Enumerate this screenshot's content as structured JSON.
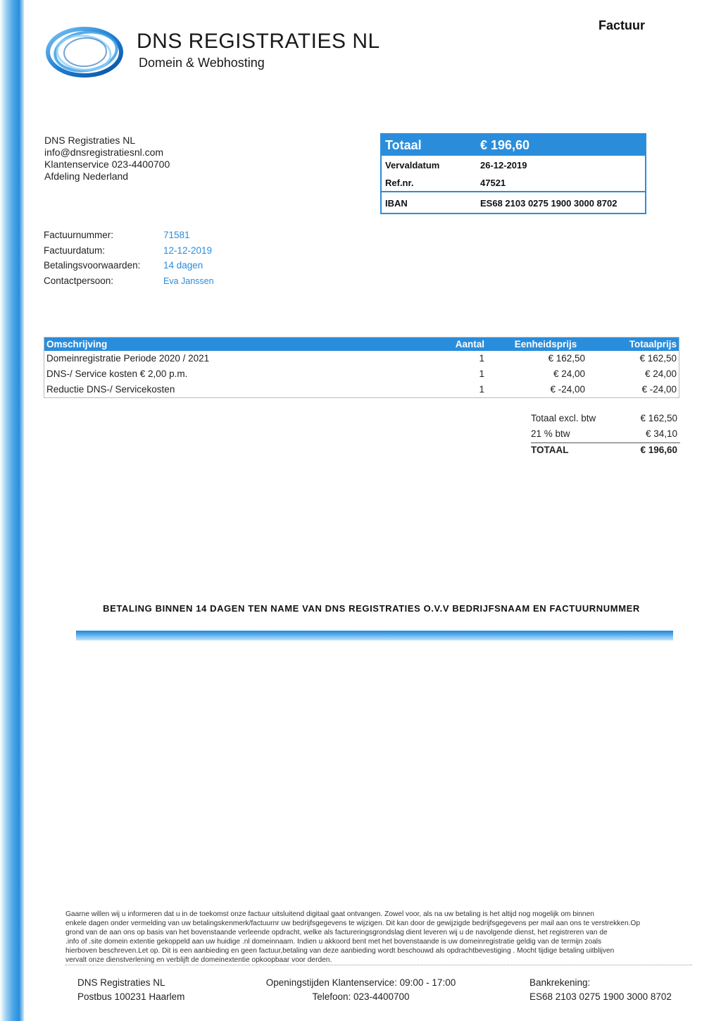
{
  "brand": {
    "name": "DNS REGISTRATIES NL",
    "tagline": "Domein & Webhosting",
    "colors": {
      "accent": "#2a8ddc",
      "text": "#222222"
    },
    "logo_icon": "ring-logo-icon"
  },
  "document": {
    "title": "Factuur"
  },
  "address": {
    "lines": [
      "DNS Registraties NL",
      "info@dnsregistratiesnl.com",
      "Klantenservice 023-4400700",
      "Afdeling Nederland"
    ]
  },
  "summary": {
    "total_label": "Totaal",
    "total_value": "€ 196,60",
    "due_label": "Vervaldatum",
    "due_value": "26-12-2019",
    "ref_label": "Ref.nr.",
    "ref_value": "47521",
    "iban_label": "IBAN",
    "iban_value": "ES68 2103 0275 1900 3000 8702"
  },
  "meta": [
    {
      "label": "Factuurnummer:",
      "value": "71581"
    },
    {
      "label": "Factuurdatum:",
      "value": "12-12-2019"
    },
    {
      "label": "Betalingsvoorwaarden:",
      "value": "14 dagen"
    },
    {
      "label": "Contactpersoon:",
      "value": "Eva Janssen"
    }
  ],
  "items": {
    "headers": {
      "description": "Omschrijving",
      "quantity": "Aantal",
      "unit_price": "Eenheidsprijs",
      "total_price": "Totaalprijs"
    },
    "rows": [
      {
        "description": "Domeinregistratie Periode 2020 / 2021",
        "quantity": "1",
        "unit_price": "€ 162,50",
        "total_price": "€ 162,50"
      },
      {
        "description": "DNS-/ Service kosten € 2,00 p.m.",
        "quantity": "1",
        "unit_price": "€ 24,00",
        "total_price": "€ 24,00"
      },
      {
        "description": "Reductie DNS-/ Servicekosten",
        "quantity": "1",
        "unit_price": "€ -24,00",
        "total_price": "€ -24,00"
      }
    ]
  },
  "totals": {
    "subtotal_label": "Totaal excl. btw",
    "subtotal_value": "€ 162,50",
    "vat_label": "21 % btw",
    "vat_value": "€ 34,10",
    "total_label": "TOTAAL",
    "total_value": "€ 196,60"
  },
  "notice": "BETALING BINNEN 14 DAGEN TEN NAME VAN DNS REGISTRATIES O.V.V BEDRIJFSNAAM EN FACTUURNUMMER",
  "disclaimer": [
    "Gaarne willen wij u informeren dat u in de toekomst onze factuur uitsluitend digitaal gaat ontvangen. Zowel voor, als na uw betaling is het altijd nog mogelijk om binnen",
    "enkele dagen onder vermelding van uw betalingskenmerk/factuurnr uw bedrijfsgegevens te wijzigen. Dit kan door de gewijzigde bedrijfsgegevens per mail aan ons te verstrekken.Op",
    "grond van de aan ons op basis van het bovenstaande verleende opdracht, welke als factureringsgrondslag dient leveren wij u de navolgende dienst, het registreren van de",
    ".info of .site domein extentie gekoppeld aan uw huidige .nl domeinnaam. Indien u akkoord bent met het bovenstaande is uw domeinregistratie geldig van de termijn zoals",
    "hierboven beschreven.Let op. Dit is een aanbieding en geen factuur,betaling van deze aanbieding wordt beschouwd als opdrachtbevestiging . Mocht tijdige betaling uitblijven",
    "vervalt onze dienstverlening en verblijft de domeinextentie opkoopbaar voor derden."
  ],
  "footer": {
    "company": "DNS Registraties NL",
    "postal": "Postbus 100231 Haarlem",
    "hours": "Openingstijden Klantenservice: 09:00 - 17:00",
    "phone": "Telefoon: 023-4400700",
    "bank_label": "Bankrekening:",
    "bank_value": "ES68 2103 0275 1900 3000 8702"
  }
}
